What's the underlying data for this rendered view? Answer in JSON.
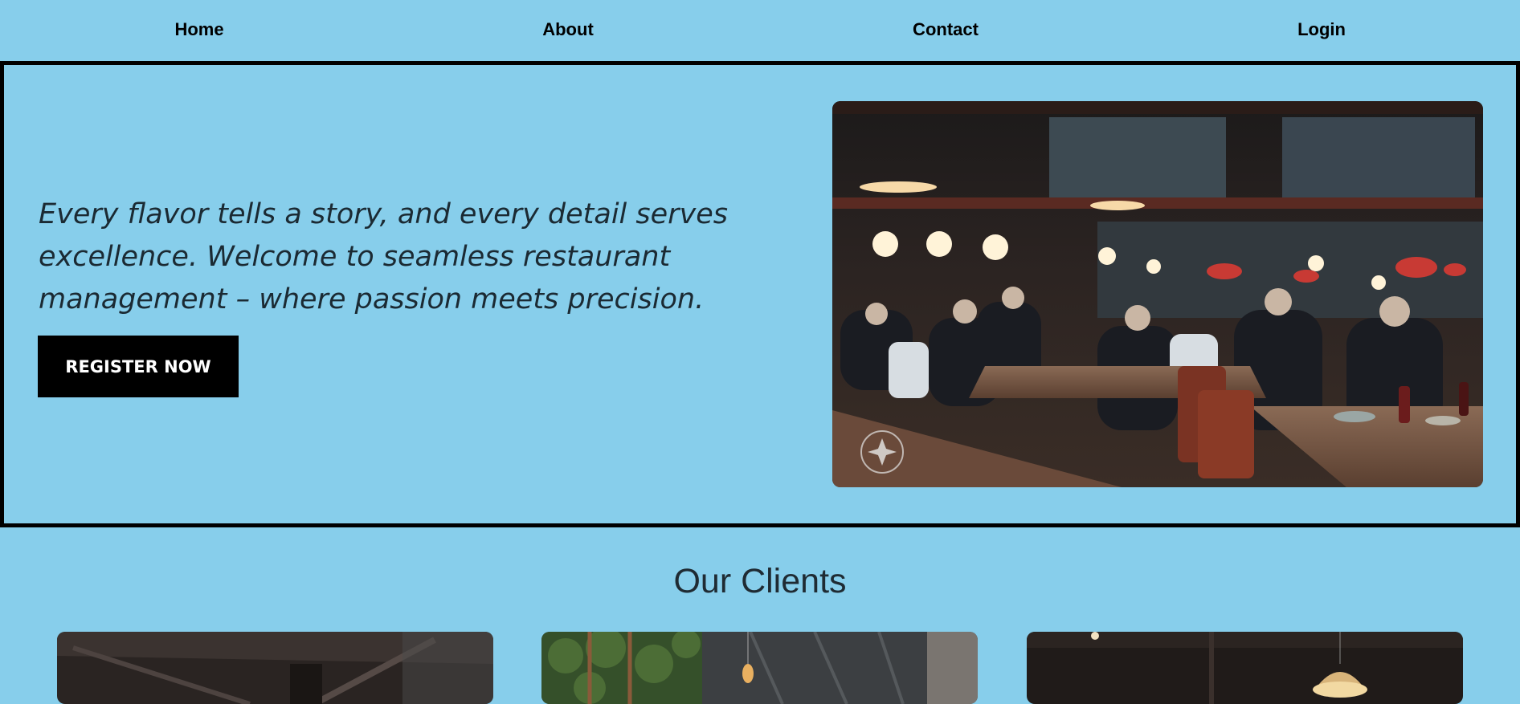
{
  "nav": {
    "items": [
      {
        "label": "Home"
      },
      {
        "label": "About"
      },
      {
        "label": "Contact"
      },
      {
        "label": "Login"
      }
    ]
  },
  "hero": {
    "tagline": "Every flavor tells a story, and every detail serves excellence. Welcome to seamless restaurant management – where passion meets precision.",
    "register_label": "REGISTER NOW",
    "image_alt": "restaurant-dining-room-image"
  },
  "clients": {
    "title": "Our Clients",
    "cards": [
      {
        "image": "restaurant-interior-image"
      },
      {
        "image": "restaurant-interior-image"
      },
      {
        "image": "restaurant-interior-image"
      }
    ]
  },
  "colors": {
    "background": "#87CEEB",
    "button": "#000000",
    "button_text": "#FFFFFF",
    "border": "#000000"
  }
}
